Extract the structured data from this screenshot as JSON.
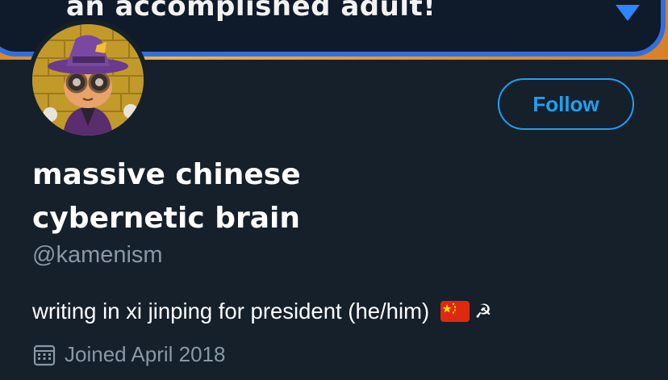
{
  "banner": {
    "text": "an accomplished adult!"
  },
  "profile": {
    "name_line1": "massive chinese",
    "name_line2": "cybernetic brain",
    "handle": "@kamenism",
    "bio": "writing in xi jinping for president (he/him)",
    "bio_emoji": [
      "china-flag",
      "hammer-and-sickle"
    ],
    "joined": "Joined April 2018"
  },
  "actions": {
    "follow_label": "Follow"
  },
  "colors": {
    "background": "#15202b",
    "accent": "#1da1f2",
    "secondary_text": "#8899a6",
    "banner_border": "#2f6fe0",
    "flag_red": "#de2910",
    "flag_yellow": "#ffde00"
  }
}
